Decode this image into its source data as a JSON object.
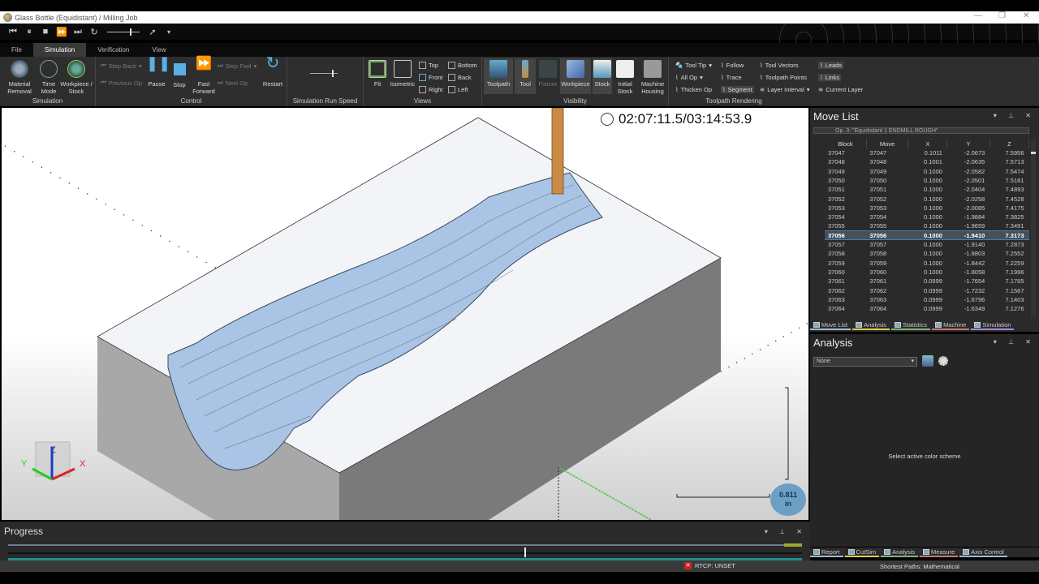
{
  "window": {
    "title": "Glass Bottle (Equidistant) / Milling Job",
    "minimize": "—",
    "restore": "❐",
    "close": "✕"
  },
  "quick_access": [
    "⏮",
    "⏸",
    "■",
    "⏩",
    "⏭",
    "↻"
  ],
  "menu_tabs": [
    {
      "label": "File",
      "active": false
    },
    {
      "label": "Simulation",
      "active": true
    },
    {
      "label": "Verification",
      "active": false
    },
    {
      "label": "View",
      "active": false
    }
  ],
  "ribbon": {
    "simulation": {
      "label": "Simulation",
      "items": [
        "Material Removal",
        "Time Mode",
        "Workpiece / Stock"
      ]
    },
    "control": {
      "label": "Control",
      "step_back": "Step Back",
      "previous_op": "Previous Op",
      "pause": "Pause",
      "stop": "Stop",
      "fast_forward": "Fast Forward",
      "step_fwd": "Step Fwd",
      "next_op": "Next Op",
      "restart": "Restart"
    },
    "run_speed": {
      "label": "Simulation Run Speed",
      "value_fraction": 0.8
    },
    "views": {
      "label": "Views",
      "fit": "Fit",
      "isometric": "Isometric",
      "top": "Top",
      "front": "Front",
      "right": "Right",
      "bottom": "Bottom",
      "back": "Back",
      "left": "Left"
    },
    "visibility": {
      "label": "Visibility",
      "items": [
        "Toolpath",
        "Tool",
        "Fixture",
        "Workpiece",
        "Stock",
        "Initial Stock",
        "Machine Housing"
      ]
    },
    "toolpath_rendering": {
      "label": "Toolpath Rendering",
      "col1": [
        "Tool Tip",
        "All Op",
        "Thicken Op"
      ],
      "col2": [
        "Follow",
        "Trace",
        "Segment"
      ],
      "col3": [
        "Tool Vectors",
        "Toolpath Points",
        "Layer Interval"
      ],
      "col4": [
        "Leads",
        "Links",
        "Current Layer"
      ]
    }
  },
  "viewport": {
    "timer": "02:07:11.5/03:14:53.9",
    "scale_value": "0.811",
    "scale_unit": "in",
    "axes": {
      "x": "X",
      "y": "Y",
      "z": "Z"
    }
  },
  "move_list": {
    "title": "Move List",
    "operation": "Op. 3: \"Equidistant 1 ENDMILL ROUGH\"",
    "columns": [
      "Block",
      "Move",
      "X",
      "Y",
      "Z"
    ],
    "selected_row": 9,
    "rows": [
      [
        "37047",
        "37047",
        "0.1011",
        "-2.0673",
        "7.5956"
      ],
      [
        "37048",
        "37048",
        "0.1001",
        "-2.0635",
        "7.5713"
      ],
      [
        "37049",
        "37049",
        "0.1000",
        "-2.0582",
        "7.5474"
      ],
      [
        "37050",
        "37050",
        "0.1000",
        "-2.0501",
        "7.5181"
      ],
      [
        "37051",
        "37051",
        "0.1000",
        "-2.0404",
        "7.4893"
      ],
      [
        "37052",
        "37052",
        "0.1000",
        "-2.0258",
        "7.4528"
      ],
      [
        "37053",
        "37053",
        "0.1000",
        "-2.0085",
        "7.4175"
      ],
      [
        "37054",
        "37054",
        "0.1000",
        "-1.9884",
        "7.3825"
      ],
      [
        "37055",
        "37055",
        "0.1000",
        "-1.9659",
        "7.3491"
      ],
      [
        "37056",
        "37056",
        "0.1000",
        "-1.9410",
        "7.3173"
      ],
      [
        "37057",
        "37057",
        "0.1000",
        "-1.9140",
        "7.2873"
      ],
      [
        "37058",
        "37058",
        "0.1000",
        "-1.8803",
        "7.2552"
      ],
      [
        "37059",
        "37059",
        "0.1000",
        "-1.8442",
        "7.2259"
      ],
      [
        "37060",
        "37060",
        "0.1000",
        "-1.8058",
        "7.1996"
      ],
      [
        "37061",
        "37061",
        "0.0999",
        "-1.7654",
        "7.1765"
      ],
      [
        "37062",
        "37062",
        "0.0999",
        "-1.7232",
        "7.1567"
      ],
      [
        "37063",
        "37063",
        "0.0999",
        "-1.6796",
        "7.1403"
      ],
      [
        "37064",
        "37064",
        "0.0999",
        "-1.6349",
        "7.1276"
      ]
    ],
    "tabs": [
      "Move List",
      "Analysis",
      "Statistics",
      "Machine",
      "Simulation"
    ]
  },
  "analysis": {
    "title": "Analysis",
    "scheme_value": "None",
    "message": "Select active color scheme",
    "tabs": [
      "Report",
      "CutSim",
      "Analysis",
      "Measure",
      "Axis Control"
    ]
  },
  "progress": {
    "title": "Progress",
    "fraction": 0.65
  },
  "status": {
    "rtcp": "RTCP: UNSET",
    "shortest_paths": "Shortest Paths: Mathematical"
  },
  "colors": {
    "accent": "#3a7fc4",
    "progress_fill": "#1e8c8c",
    "tool": "#c98a45",
    "material": "#a9c4e4"
  }
}
